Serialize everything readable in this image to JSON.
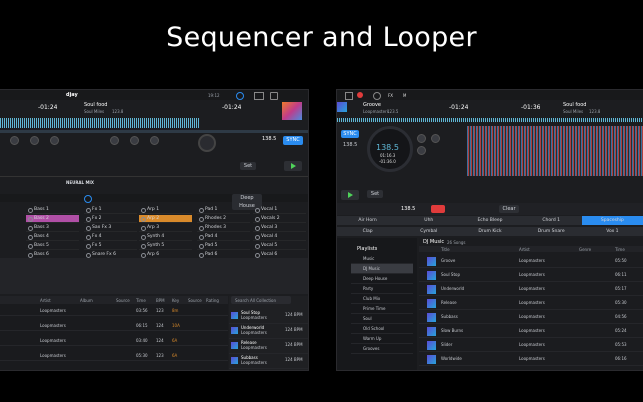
{
  "banner": {
    "title": "Sequencer and Looper"
  },
  "left": {
    "brand": "djay",
    "clock": "19:12",
    "time_left": "-01:24",
    "time_right": "-01:24",
    "track": {
      "title": "Soul food",
      "artist": "Soul Miles",
      "bpm": "123.8"
    },
    "bpm": "138.5",
    "sync_label": "SYNC",
    "set_label": "Set",
    "neural_label": "NEURAL MIX",
    "pad_header": {
      "preset": "Deep House"
    },
    "pad_columns": [
      [
        "Bass 1",
        "Bass 2",
        "Bass 3",
        "Bass 4",
        "Bass 5",
        "Bass 6"
      ],
      [
        "Fx 1",
        "Fx 2",
        "Sax Fx 3",
        "Fx 4",
        "Fx 5",
        "Snare Fx 6"
      ],
      [
        "Arp 1",
        "Arp 2",
        "Arp 3",
        "Synth 4",
        "Synth 5",
        "Arp 6"
      ],
      [
        "Pad 1",
        "Rhodes 2",
        "Rhodes 3",
        "Pad 4",
        "Pad 5",
        "Pad 6"
      ],
      [
        "Vocal 1",
        "Vocals 2",
        "Vocal 3",
        "Vocal 4",
        "Vocal 5",
        "Vocal 6"
      ]
    ],
    "library": {
      "headers": [
        "Artist",
        "Album",
        "Source",
        "Time",
        "BPM",
        "Key",
        "Source",
        "Rating"
      ],
      "rows": [
        {
          "artist": "Loopmasters",
          "time": "03:56",
          "bpm": "123",
          "key": "8m"
        },
        {
          "artist": "Loopmasters",
          "time": "06:15",
          "bpm": "124",
          "key": "10A"
        },
        {
          "artist": "Loopmasters",
          "time": "03:40",
          "bpm": "124",
          "key": "6A"
        },
        {
          "artist": "Loopmasters",
          "time": "05:30",
          "bpm": "123",
          "key": "6A"
        }
      ],
      "search_placeholder": "Search All Collection",
      "side_tracks": [
        {
          "title": "Soul Stop",
          "artist": "Loopmasters",
          "bpm": "124 BPM"
        },
        {
          "title": "Underworld",
          "artist": "Loopmasters",
          "bpm": "124 BPM"
        },
        {
          "title": "Release",
          "artist": "Loopmasters",
          "bpm": "124 BPM"
        },
        {
          "title": "Subbass",
          "artist": "Loopmasters",
          "bpm": "124 BPM"
        }
      ]
    }
  },
  "right": {
    "track": {
      "title": "Groove",
      "artist": "Loopmasters",
      "bpm": "123.5"
    },
    "time_left": "-01:24",
    "time_right": "-01:36",
    "bpm_big": "138.5",
    "elapsed": "01:16.3",
    "remaining": "-01:36.0",
    "track2": {
      "title": "Soul food",
      "artist": "Soul Miles",
      "bpm": "123.8"
    },
    "sync_label": "SYNC",
    "bpm_small": "138.5",
    "set_label": "Set",
    "clear_label": "Clear",
    "fx_row1": [
      "Air Horn",
      "Uhh",
      "Echo Bleep",
      "Chord 1",
      "Spaceship"
    ],
    "fx_row2": [
      "Clap",
      "Cymbal",
      "Drum Kick",
      "Drum Snare",
      "Vox 1"
    ],
    "library": {
      "header": "DJ Music",
      "count": "26 Songs",
      "columns": [
        "Title",
        "Artist",
        "Genre",
        "Time"
      ],
      "sidebar_title": "Playlists",
      "sidebar": [
        "Music",
        "DJ Music",
        "Deep House",
        "Party",
        "Club Mix",
        "Prime Time",
        "Soul",
        "Old School",
        "Warm Up",
        "Grooves"
      ],
      "rows": [
        {
          "title": "Groove",
          "artist": "Loopmasters",
          "time": "05:50"
        },
        {
          "title": "Soul Stop",
          "artist": "Loopmasters",
          "time": "06:11"
        },
        {
          "title": "Underworld",
          "artist": "Loopmasters",
          "time": "05:17"
        },
        {
          "title": "Release",
          "artist": "Loopmasters",
          "time": "05:30"
        },
        {
          "title": "Subbass",
          "artist": "Loopmasters",
          "time": "04:56"
        },
        {
          "title": "Slow Burns",
          "artist": "Loopmasters",
          "time": "05:24"
        },
        {
          "title": "Slider",
          "artist": "Loopmasters",
          "time": "05:53"
        },
        {
          "title": "Worldwide",
          "artist": "Loopmasters",
          "time": "06:16"
        }
      ]
    }
  },
  "colors": {
    "accent": "#2a8cf0",
    "pad_pink": "#b04fa6",
    "pad_orange": "#d98a2b",
    "play_green": "#4fd25a",
    "rec_red": "#e03b3b",
    "wave": "#5fb8d6"
  }
}
